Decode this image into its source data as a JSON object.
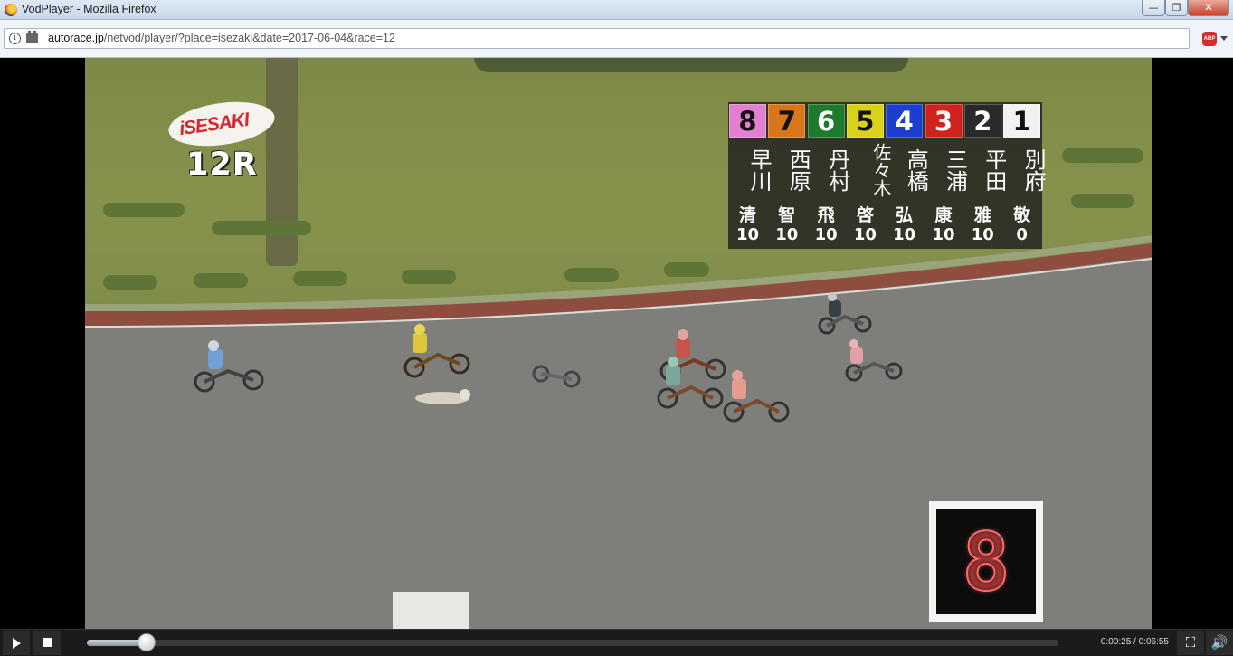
{
  "window": {
    "title": "VodPlayer - Mozilla Firefox",
    "minimize_glyph": "—",
    "maximize_glyph": "❐",
    "close_glyph": "✕"
  },
  "address_bar": {
    "url_domain": "autorace.jp",
    "url_path": "/netvod/player/?place=isezaki&date=2017-06-04&race=12",
    "info_glyph": "i",
    "adblock_label": "ABP"
  },
  "video": {
    "logo_text": "iSESAKI",
    "race_label": "12R",
    "lap_counter": "8",
    "riders": [
      {
        "number": "8",
        "surname": "早川",
        "given": "清",
        "handicap": "10",
        "color": "#e27fd0",
        "text_color": "#111111"
      },
      {
        "number": "7",
        "surname": "西原",
        "given": "智",
        "handicap": "10",
        "color": "#d9761c",
        "text_color": "#111111"
      },
      {
        "number": "6",
        "surname": "丹村",
        "given": "飛",
        "handicap": "10",
        "color": "#1e7a2c",
        "text_color": "#ffffff"
      },
      {
        "number": "5",
        "surname": "佐々木",
        "given": "啓",
        "handicap": "10",
        "color": "#d9d21c",
        "text_color": "#111111"
      },
      {
        "number": "4",
        "surname": "高橋",
        "given": "弘",
        "handicap": "10",
        "color": "#1c3fcf",
        "text_color": "#ffffff"
      },
      {
        "number": "3",
        "surname": "三浦",
        "given": "康",
        "handicap": "10",
        "color": "#d0231d",
        "text_color": "#ffffff"
      },
      {
        "number": "2",
        "surname": "平田",
        "given": "雅",
        "handicap": "10",
        "color": "#2a2a2a",
        "text_color": "#ffffff"
      },
      {
        "number": "1",
        "surname": "別府",
        "given": "敬",
        "handicap": "0",
        "color": "#f2f2f2",
        "text_color": "#111111"
      }
    ]
  },
  "player": {
    "play_icon": "play-icon",
    "stop_icon": "stop-icon",
    "progress_fraction": 0.0612,
    "current_time": "0:00:25",
    "duration": "0:06:55",
    "time_separator": " / ",
    "fullscreen_glyph": "⛶",
    "volume_glyph": "🔊"
  }
}
